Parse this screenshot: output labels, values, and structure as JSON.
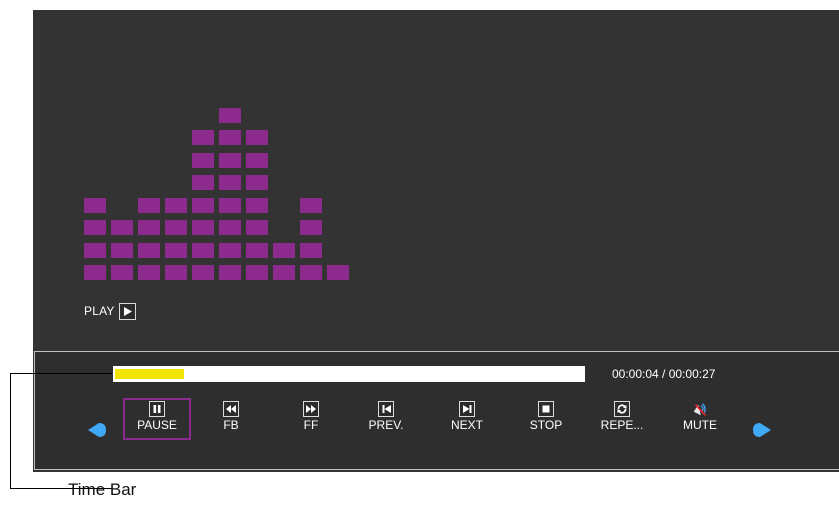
{
  "playback": {
    "status_label": "PLAY",
    "status_icon": "play-icon",
    "elapsed": "00:00:04",
    "total": "00:00:27",
    "time_display": "00:00:04 / 00:00:27",
    "progress_fraction": 0.148
  },
  "equalizer": {
    "color": "#8d2a8d",
    "column_heights": [
      4,
      3,
      4,
      4,
      7,
      8,
      7,
      2,
      4,
      1
    ]
  },
  "controls": [
    {
      "id": "pause",
      "label": "PAUSE",
      "icon": "pause-icon",
      "selected": true
    },
    {
      "id": "fb",
      "label": "FB",
      "icon": "fast-backward-icon",
      "selected": false
    },
    {
      "id": "ff",
      "label": "FF",
      "icon": "fast-forward-icon",
      "selected": false
    },
    {
      "id": "prev",
      "label": "PREV.",
      "icon": "previous-track-icon",
      "selected": false
    },
    {
      "id": "next",
      "label": "NEXT",
      "icon": "next-track-icon",
      "selected": false
    },
    {
      "id": "stop",
      "label": "STOP",
      "icon": "stop-icon",
      "selected": false
    },
    {
      "id": "repeat",
      "label": "REPE...",
      "icon": "repeat-icon",
      "selected": false
    },
    {
      "id": "mute",
      "label": "MUTE",
      "icon": "mute-icon",
      "selected": false
    }
  ],
  "nav": {
    "left_icon": "arrow-left-icon",
    "right_icon": "arrow-right-icon",
    "color": "#3fa9f5"
  },
  "annotation": {
    "caption": "Time Bar"
  },
  "colors": {
    "screen": "#333333",
    "progress": "#f2e600",
    "selection": "#8d2a8d",
    "accent": "#3fa9f5"
  }
}
